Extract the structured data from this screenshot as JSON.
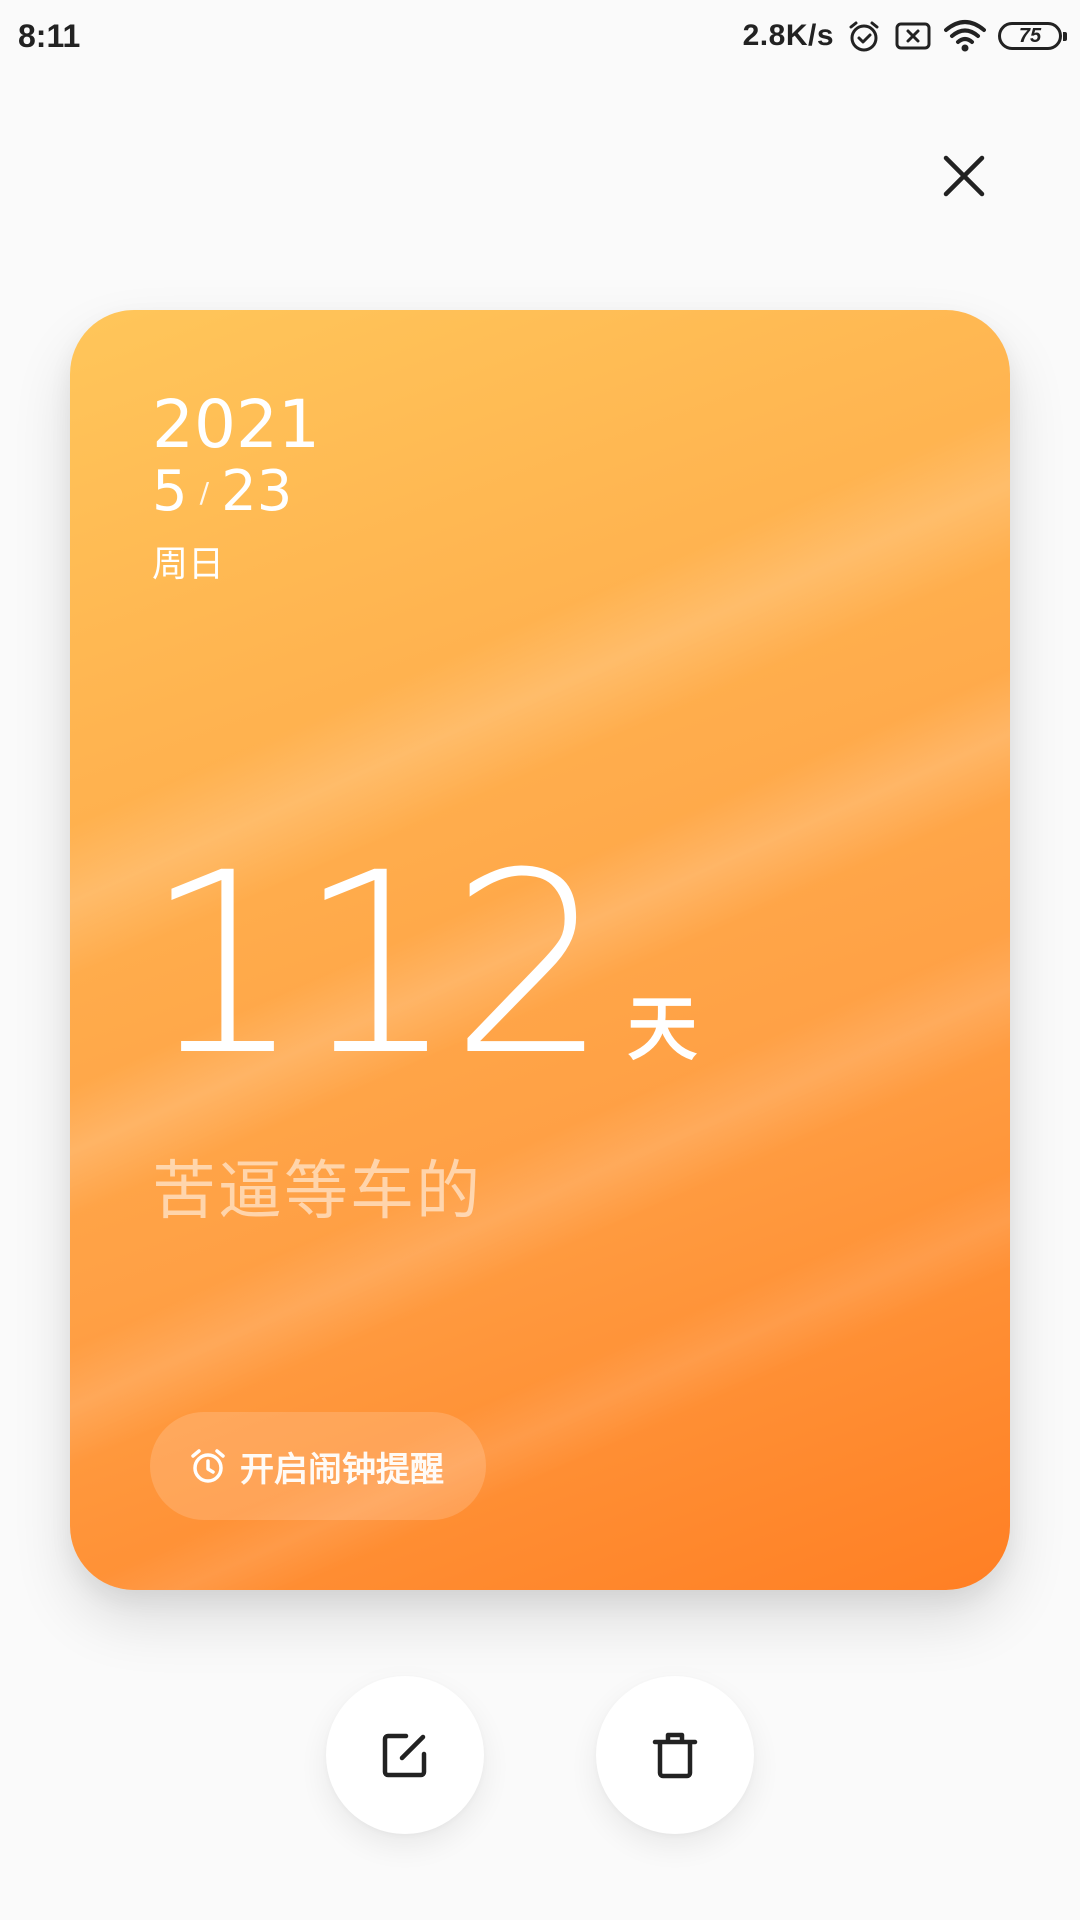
{
  "status_bar": {
    "time": "8:11",
    "network_speed": "2.8K/s",
    "battery_level": "75",
    "icons": [
      "alarm-icon",
      "sim-no-signal-icon",
      "wifi-icon",
      "battery-icon"
    ]
  },
  "card": {
    "year": "2021",
    "month": "5",
    "slash": "/",
    "day": "23",
    "weekday": "周日",
    "day_count": "112",
    "unit": "天",
    "event_title": "苦逼等车的",
    "alarm_label": "开启闹钟提醒",
    "colors": {
      "gradient_start": "#ffc65a",
      "gradient_end": "#ff7f24"
    }
  },
  "actions": {
    "close_icon": "close-icon",
    "edit_icon": "edit-icon",
    "delete_icon": "trash-icon"
  }
}
